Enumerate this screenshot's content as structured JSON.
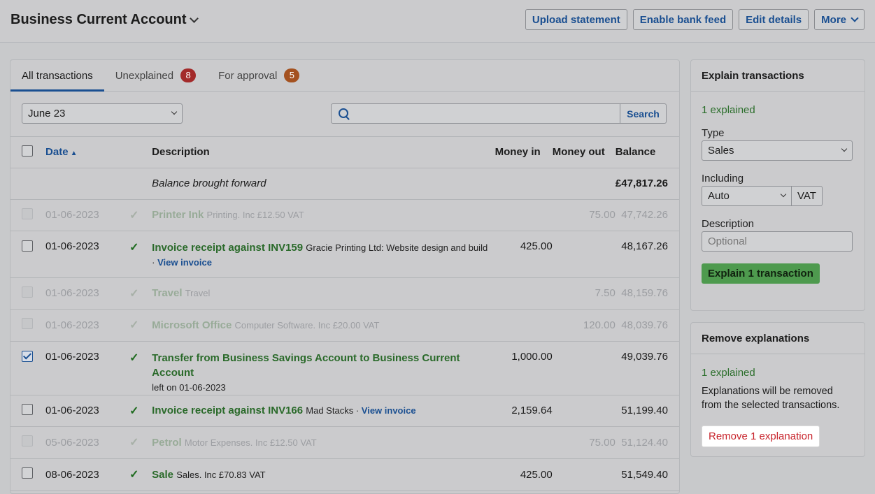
{
  "header": {
    "account_title": "Business Current Account",
    "actions": [
      "Upload statement",
      "Enable bank feed",
      "Edit details",
      "More"
    ]
  },
  "tabs": [
    {
      "label": "All transactions",
      "badge": ""
    },
    {
      "label": "Unexplained",
      "badge": "8"
    },
    {
      "label": "For approval",
      "badge": "5"
    }
  ],
  "filter": {
    "month": "June 23",
    "search_placeholder": "",
    "search_label": "Search"
  },
  "table": {
    "columns": {
      "date": "Date",
      "description": "Description",
      "money_in": "Money in",
      "money_out": "Money out",
      "balance": "Balance"
    },
    "brought_forward": {
      "label": "Balance brought forward",
      "balance": "£47,817.26"
    },
    "rows": [
      {
        "date": "01-06-2023",
        "title": "Printer Ink",
        "sub": "Printing. Inc £12.50 VAT",
        "link": "",
        "line2": "",
        "in": "",
        "out": "75.00",
        "balance": "47,742.26"
      },
      {
        "date": "01-06-2023",
        "title": "Invoice receipt against INV159",
        "sub": "Gracie Printing Ltd: Website design and build",
        "link": "View invoice",
        "line2": "",
        "in": "425.00",
        "out": "",
        "balance": "48,167.26"
      },
      {
        "date": "01-06-2023",
        "title": "Travel",
        "sub": "Travel",
        "link": "",
        "line2": "",
        "in": "",
        "out": "7.50",
        "balance": "48,159.76"
      },
      {
        "date": "01-06-2023",
        "title": "Microsoft Office",
        "sub": "Computer Software. Inc £20.00 VAT",
        "link": "",
        "line2": "",
        "in": "",
        "out": "120.00",
        "balance": "48,039.76"
      },
      {
        "date": "01-06-2023",
        "title": "Transfer from Business Savings Account to Business Current Account",
        "sub": "",
        "link": "",
        "line2": "left on 01-06-2023",
        "in": "1,000.00",
        "out": "",
        "balance": "49,039.76"
      },
      {
        "date": "01-06-2023",
        "title": "Invoice receipt against INV166",
        "sub": "Mad Stacks",
        "link": "View invoice",
        "line2": "",
        "in": "2,159.64",
        "out": "",
        "balance": "51,199.40"
      },
      {
        "date": "05-06-2023",
        "title": "Petrol",
        "sub": "Motor Expenses. Inc £12.50 VAT",
        "link": "",
        "line2": "",
        "in": "",
        "out": "75.00",
        "balance": "51,124.40"
      },
      {
        "date": "08-06-2023",
        "title": "Sale",
        "sub": "Sales. Inc £70.83 VAT",
        "link": "",
        "line2": "",
        "in": "425.00",
        "out": "",
        "balance": "51,549.40"
      }
    ]
  },
  "explain": {
    "heading": "Explain transactions",
    "count": "1 explained",
    "type_label": "Type",
    "type_value": "Sales",
    "including_label": "Including",
    "including_value": "Auto",
    "vat_label": "VAT",
    "description_label": "Description",
    "description_placeholder": "Optional",
    "button": "Explain 1 transaction"
  },
  "remove": {
    "heading": "Remove explanations",
    "count": "1 explained",
    "text": "Explanations will be removed from the selected transactions.",
    "button": "Remove 1 explanation"
  }
}
